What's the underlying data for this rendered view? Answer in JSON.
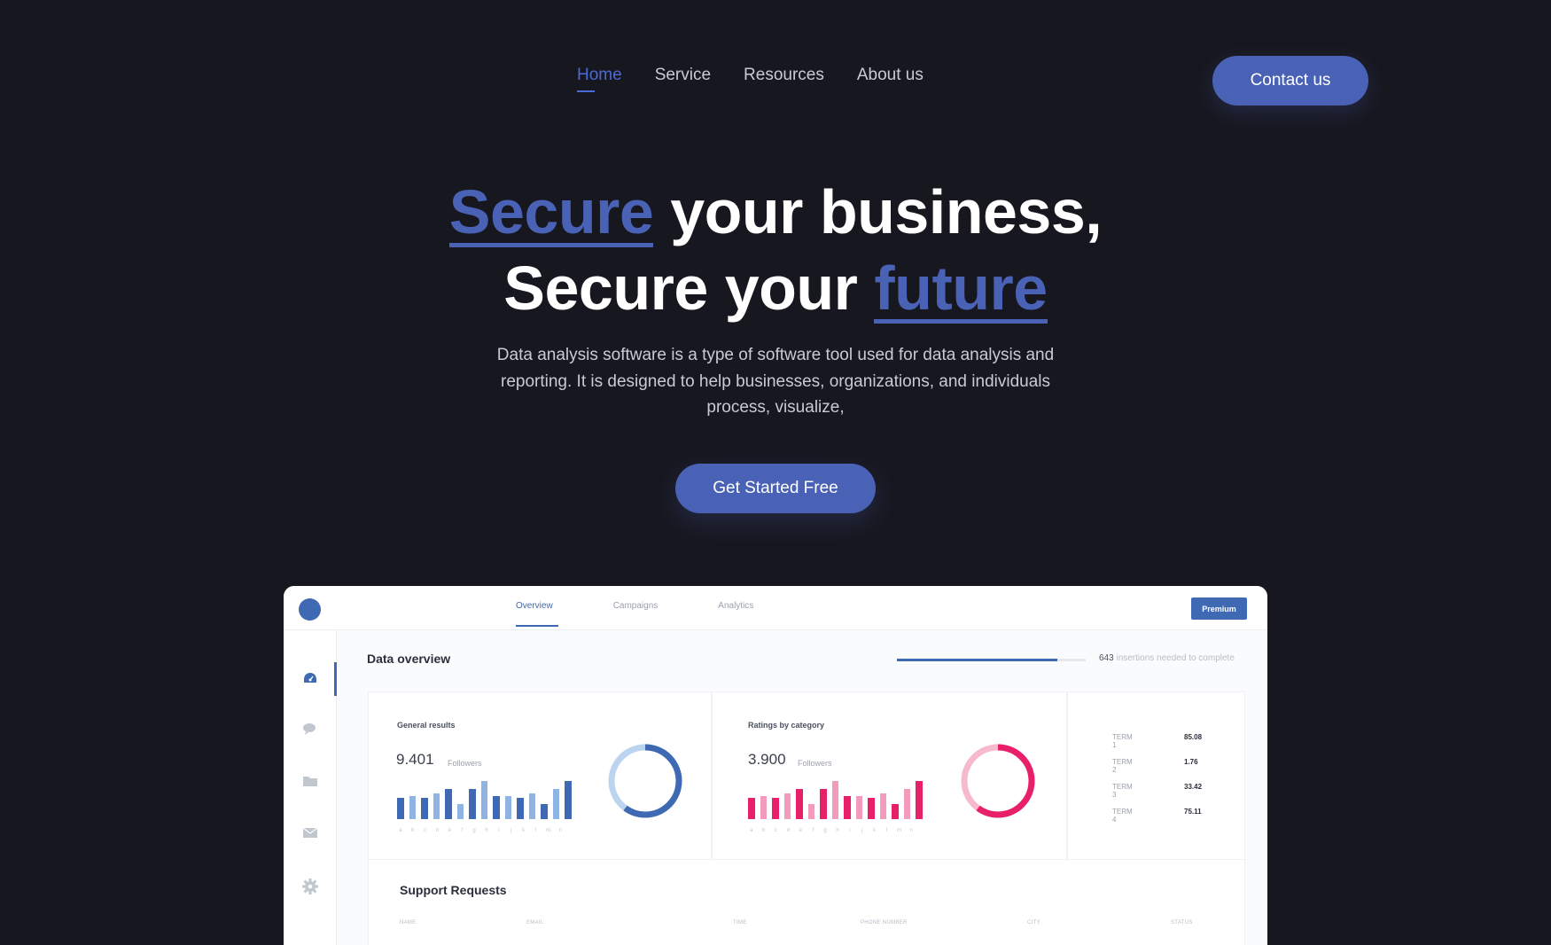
{
  "nav": {
    "items": [
      "Home",
      "Service",
      "Resources",
      "About us"
    ],
    "contact": "Contact us"
  },
  "hero": {
    "line1_accent": "Secure",
    "line1_rest": " your business,",
    "line2_start": "Secure your ",
    "line2_accent": "future",
    "subtitle": "Data analysis software is a type of software tool used for data analysis and reporting. It is designed to help businesses, organizations, and individuals process, visualize,",
    "cta": "Get Started Free"
  },
  "dashboard": {
    "tabs": [
      "Overview",
      "Campaigns",
      "Analytics"
    ],
    "premium": "Premium",
    "sidebar_icons": [
      "dashboard-icon",
      "chat-icon",
      "folder-icon",
      "mail-icon",
      "settings-icon"
    ],
    "heading": "Data overview",
    "progress": {
      "fraction": 0.85,
      "count": "643",
      "text": " insertions needed to complete"
    },
    "colors": {
      "accent": "#3f6ab3",
      "blue_light": "#8fb3e3",
      "pink": "#e8206a",
      "pink_light": "#f39bbd"
    },
    "general": {
      "title": "General results",
      "value": "9.401",
      "label": "Followers",
      "bar_labels": [
        "a",
        "b",
        "c",
        "d",
        "e",
        "f",
        "g",
        "h",
        "i",
        "j",
        "k",
        "l",
        "m",
        "n"
      ],
      "bars": [
        0.5,
        0.55,
        0.5,
        0.6,
        0.7,
        0.35,
        0.7,
        0.9,
        0.55,
        0.55,
        0.5,
        0.6,
        0.35,
        0.7,
        0.9
      ],
      "donut_fraction": 0.6
    },
    "ratings": {
      "title": "Ratings by category",
      "value": "3.900",
      "label": "Followers",
      "bar_labels": [
        "a",
        "b",
        "c",
        "d",
        "e",
        "f",
        "g",
        "h",
        "i",
        "j",
        "k",
        "l",
        "m",
        "n"
      ],
      "bars": [
        0.5,
        0.55,
        0.5,
        0.6,
        0.7,
        0.35,
        0.7,
        0.9,
        0.55,
        0.55,
        0.5,
        0.6,
        0.35,
        0.7,
        0.9
      ],
      "donut_fraction": 0.6
    },
    "terms": [
      {
        "name": "TERM 1",
        "value": "85.08"
      },
      {
        "name": "TERM 2",
        "value": "1.76"
      },
      {
        "name": "TERM 3",
        "value": "33.42"
      },
      {
        "name": "TERM 4",
        "value": "75.11"
      }
    ],
    "support": {
      "title": "Support Requests",
      "columns": [
        "NAME",
        "EMAIL",
        "TIME",
        "PHONE NUMBER",
        "CITY",
        "STATUS"
      ]
    }
  }
}
